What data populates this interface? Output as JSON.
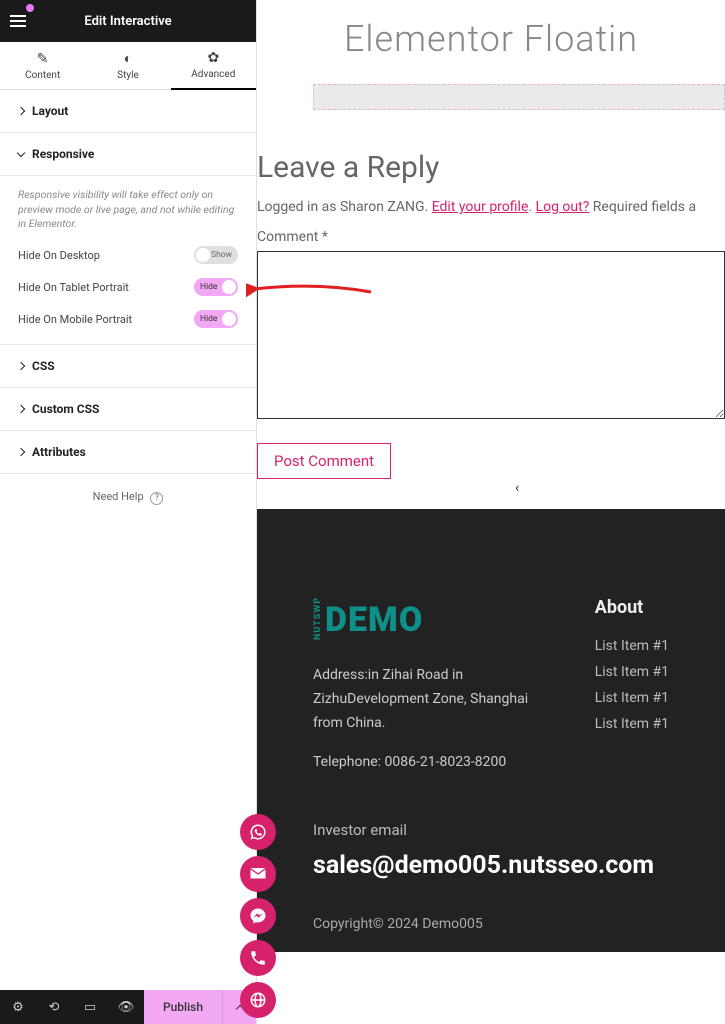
{
  "header": {
    "title": "Edit Interactive"
  },
  "tabs": {
    "content": "Content",
    "style": "Style",
    "advanced": "Advanced"
  },
  "sections": {
    "layout": "Layout",
    "responsive": "Responsive",
    "css": "CSS",
    "customCss": "Custom CSS",
    "attributes": "Attributes"
  },
  "responsive": {
    "info": "Responsive visibility will take effect only on preview mode or live page, and not while editing in Elementor.",
    "hideDesktop": "Hide On Desktop",
    "hideTablet": "Hide On Tablet Portrait",
    "hideMobile": "Hide On Mobile Portrait",
    "showText": "Show",
    "hideText": "Hide"
  },
  "help": "Need Help",
  "publish": "Publish",
  "preview": {
    "pageTitle": "Elementor Floatin",
    "replyTitle": "Leave a Reply",
    "loggedPrefix": "Logged in as Sharon ZANG. ",
    "editProfile": "Edit your profile",
    "logout": "Log out?",
    "requiredSuffix": " Required fields a",
    "commentLabel": "Comment *",
    "postBtn": "Post Comment",
    "scrollInd": "‹"
  },
  "footer": {
    "logoSide": "NUTSWP",
    "logoMain": "DEMO",
    "address": "Address:in Zihai Road in ZizhuDevelopment Zone, Shanghai from China.",
    "telephone": "Telephone: 0086-21-8023-8200",
    "about": "About",
    "items": [
      "List Item #1",
      "List Item #1",
      "List Item #1",
      "List Item #1"
    ],
    "investor": "Investor email",
    "sales": "sales@demo005.nutsseo.com",
    "copyright": "Copyright© 2024 Demo005"
  }
}
